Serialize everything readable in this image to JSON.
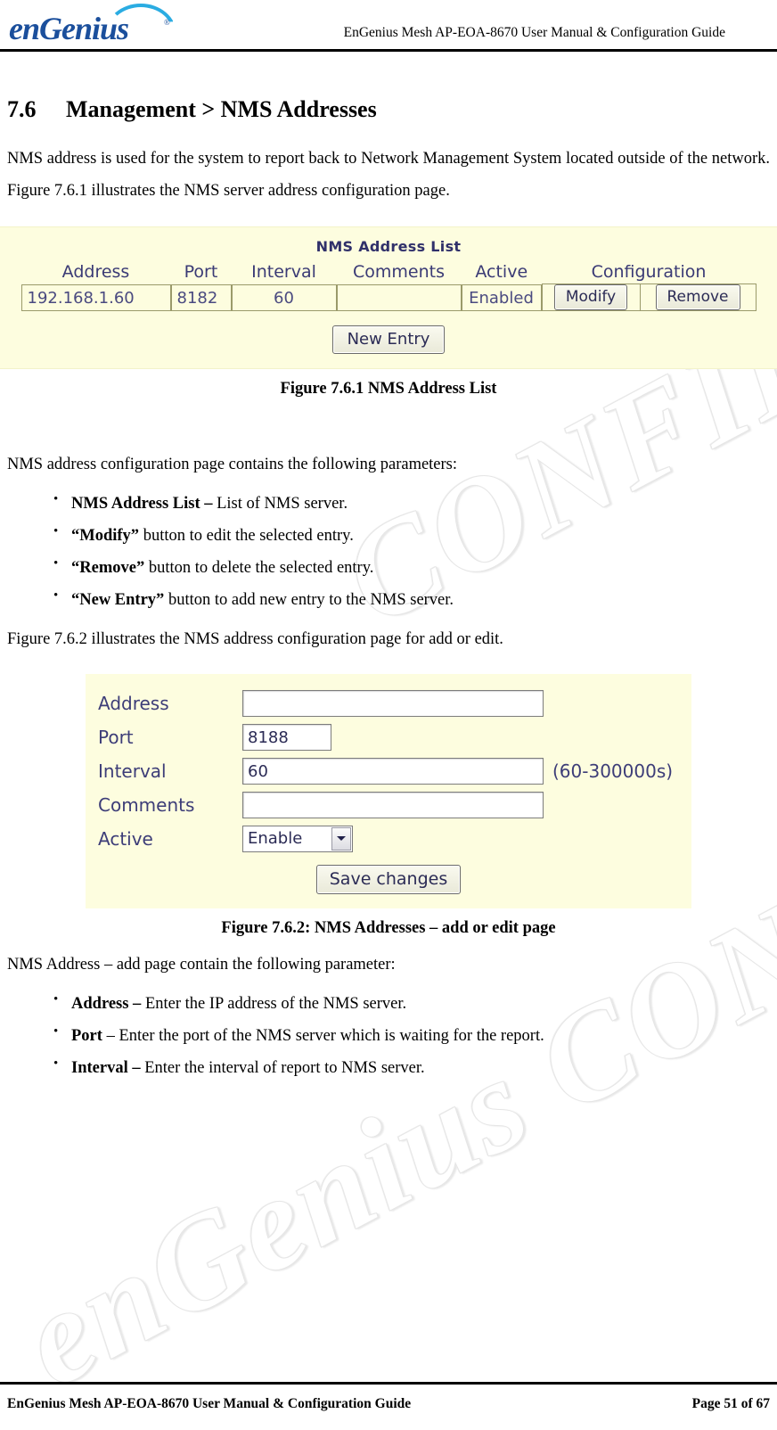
{
  "header": {
    "logo_text": "enGenius",
    "logo_reg": "®",
    "title": "EnGenius Mesh AP-EOA-8670 User Manual & Configuration Guide"
  },
  "watermark": {
    "line1": "CONFIDENTIAL",
    "line2": "enGenius CONFIDENTIAL"
  },
  "section": {
    "number": "7.6",
    "title": "Management > NMS Addresses",
    "intro": "NMS address is used for the system to report back to Network Management System located outside of the network. Figure 7.6.1 illustrates the NMS server address configuration page."
  },
  "figure1": {
    "panel_title": "NMS Address List",
    "columns": [
      "Address",
      "Port",
      "Interval",
      "Comments",
      "Active",
      "Configuration"
    ],
    "row": {
      "address": "192.168.1.60",
      "port": "8182",
      "interval": "60",
      "comments": "",
      "active": "Enabled",
      "modify_label": "Modify",
      "remove_label": "Remove"
    },
    "new_entry_label": "New Entry",
    "caption": "Figure 7.6.1 NMS Address List"
  },
  "params_intro": "NMS address configuration page contains the following parameters:",
  "params_list": [
    {
      "bold": "NMS Address List – ",
      "rest": "List of NMS server."
    },
    {
      "bold": "“Modify” ",
      "rest": "button to edit the selected entry."
    },
    {
      "bold": "“Remove” ",
      "rest": "button to delete the selected entry."
    },
    {
      "bold": "“New Entry” ",
      "rest": "button to add new entry to the NMS server."
    }
  ],
  "fig2_intro": "Figure 7.6.2 illustrates the NMS address configuration page for add or edit.",
  "figure2": {
    "labels": {
      "address": "Address",
      "port": "Port",
      "interval": "Interval",
      "comments": "Comments",
      "active": "Active"
    },
    "values": {
      "address": "",
      "port": "8188",
      "interval": "60",
      "comments": "",
      "active": "Enable"
    },
    "placeholders": {
      "address": "",
      "comments": ""
    },
    "interval_hint": "(60-300000s)",
    "save_label": "Save changes",
    "caption": "Figure 7.6.2: NMS Addresses – add or edit page"
  },
  "params2_intro": "NMS Address – add page contain the following parameter:",
  "params2_list": [
    {
      "bold": "Address – ",
      "rest": "Enter the IP address of the NMS server."
    },
    {
      "bold": "Port ",
      "rest": "– Enter the port of the NMS server which is waiting for the report."
    },
    {
      "bold": "Interval – ",
      "rest": "Enter the interval of report to NMS server."
    }
  ],
  "footer": {
    "left": "EnGenius Mesh AP-EOA-8670 User Manual & Configuration Guide",
    "right": "Page 51 of 67"
  }
}
